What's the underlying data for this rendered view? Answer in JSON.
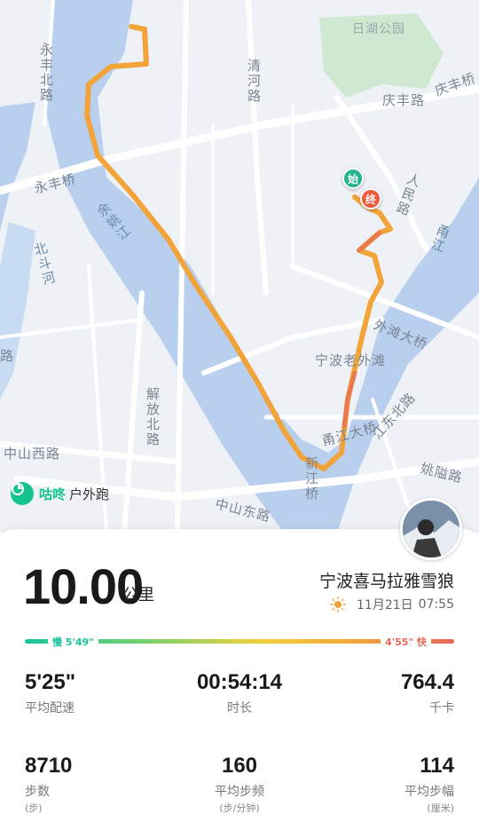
{
  "map": {
    "labels": {
      "park": "日湖公园",
      "road_yongfeng_north": "永丰北路",
      "road_qinghe": "清河路",
      "road_qingfeng": "庆丰路",
      "bridge_qingfeng": "庆丰桥",
      "bridge_yongfeng": "永丰桥",
      "river_yuyao": "余姚江",
      "road_renmin": "人民路",
      "river_yong": "甬江",
      "river_beidou": "北斗河",
      "bridge_waitan": "外滩大桥",
      "area_waitan": "宁波老外滩",
      "road_jiefang_north": "解放北路",
      "bridge_yongjiang": "甬江大桥",
      "road_jiangdong_north": "江东北路",
      "road_zhongshan_west": "中山西路",
      "bridge_xinjiang": "新江桥",
      "road_yaoyang": "姚隘路",
      "road_zhongshan_east": "中山东路",
      "road_partial": "路"
    },
    "start_marker": "始",
    "end_marker": "终",
    "route_color": "#f2a33a"
  },
  "brand": {
    "name": "咕咚",
    "subtitle": "户外跑",
    "color": "#14c38e"
  },
  "summary": {
    "distance": "10.00",
    "distance_unit": "公里",
    "username": "宁波喜马拉雅雪狼",
    "date": "11月21日",
    "time": "07:55",
    "weather_icon": "sun-icon"
  },
  "pace_range": {
    "slow_label": "慢 5'49\"",
    "fast_label": "4'55\" 快",
    "slow_color": "#18c49a",
    "fast_color": "#e8675a"
  },
  "stats": {
    "avg_pace": {
      "value": "5'25\"",
      "label": "平均配速"
    },
    "duration": {
      "value": "00:54:14",
      "label": "时长"
    },
    "calories": {
      "value": "764.4",
      "label": "千卡"
    },
    "steps": {
      "value": "8710",
      "label": "步数",
      "unit": "(步)"
    },
    "cadence": {
      "value": "160",
      "label": "平均步频",
      "unit": "(步/分钟)"
    },
    "stride": {
      "value": "114",
      "label": "平均步幅",
      "unit": "(厘米)"
    }
  }
}
